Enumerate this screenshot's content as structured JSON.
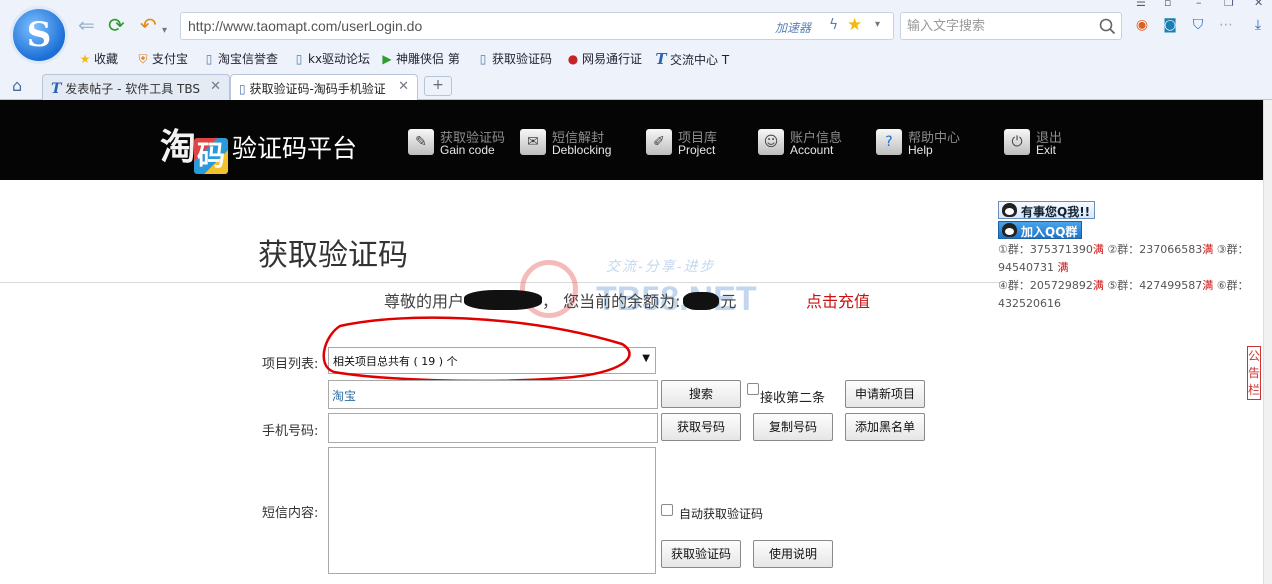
{
  "browser": {
    "url": "http://www.taomapt.com/userLogin.do",
    "accelerator_label": "加速器",
    "search_placeholder": "输入文字搜索",
    "bookmarks": [
      "收藏",
      "支付宝",
      "淘宝信誉查",
      "kx驱动论坛",
      "神雕侠侣 第",
      "获取验证码",
      "网易通行证",
      "交流中心 T"
    ],
    "tabs": [
      {
        "label": "发表帖子 - 软件工具 TBS",
        "active": false
      },
      {
        "label": "获取验证码-淘码手机验证",
        "active": true
      }
    ],
    "new_tab_label": "+"
  },
  "site": {
    "logo_text_1": "淘",
    "logo_text_2": "码",
    "logo_name": "验证码平台",
    "menu": [
      {
        "cn": "获取验证码",
        "en": "Gain code",
        "icon": "gain-code-icon"
      },
      {
        "cn": "短信解封",
        "en": "Deblocking",
        "icon": "deblocking-icon"
      },
      {
        "cn": "项目库",
        "en": "Project",
        "icon": "project-icon"
      },
      {
        "cn": "账户信息",
        "en": "Account",
        "icon": "account-icon"
      },
      {
        "cn": "帮助中心",
        "en": "Help",
        "icon": "help-icon"
      },
      {
        "cn": "退出",
        "en": "Exit",
        "icon": "exit-icon"
      }
    ]
  },
  "content": {
    "page_title": "获取验证码",
    "greeting_prefix": "尊敬的用户",
    "greeting_middle": "，  您当前的余额为:",
    "greeting_unit": "元",
    "recharge_link": "点击充值",
    "watermark_slogan": "交流-分享-进步",
    "watermark_site": "TB58.NET",
    "form": {
      "project_label": "项目列表:",
      "project_selected": "相关项目总共有 ( 19 ) 个",
      "keyword_value": "淘宝",
      "search_button": "搜索",
      "receive_second_label": "接收第二条",
      "apply_project_button": "申请新项目",
      "phone_label": "手机号码:",
      "get_number_button": "获取号码",
      "copy_number_button": "复制号码",
      "blacklist_button": "添加黑名单",
      "sms_label": "短信内容:",
      "auto_code_label": "自动获取验证码",
      "get_code_button": "获取验证码",
      "instructions_button": "使用说明"
    }
  },
  "sidebar": {
    "qq_contact": "有事您Q我!!",
    "qq_group": "加入QQ群",
    "groups": [
      {
        "prefix": "①群：",
        "number": "375371390",
        "status": "满"
      },
      {
        "prefix": "②群：",
        "number": "237066583",
        "status": "满"
      },
      {
        "prefix": "③群：",
        "number": "94540731",
        "status": "满"
      },
      {
        "prefix": "④群：",
        "number": "205729892",
        "status": "满"
      },
      {
        "prefix": "⑤群：",
        "number": "427499587",
        "status": "满"
      },
      {
        "prefix": "⑥群：",
        "number": "432520616",
        "status": ""
      }
    ],
    "notice_tab": "公告栏"
  },
  "colors": {
    "header_bg": "#050505",
    "link_red": "#cc1111",
    "keyword_blue": "#2e6da4",
    "annotation_red": "#e00000"
  }
}
